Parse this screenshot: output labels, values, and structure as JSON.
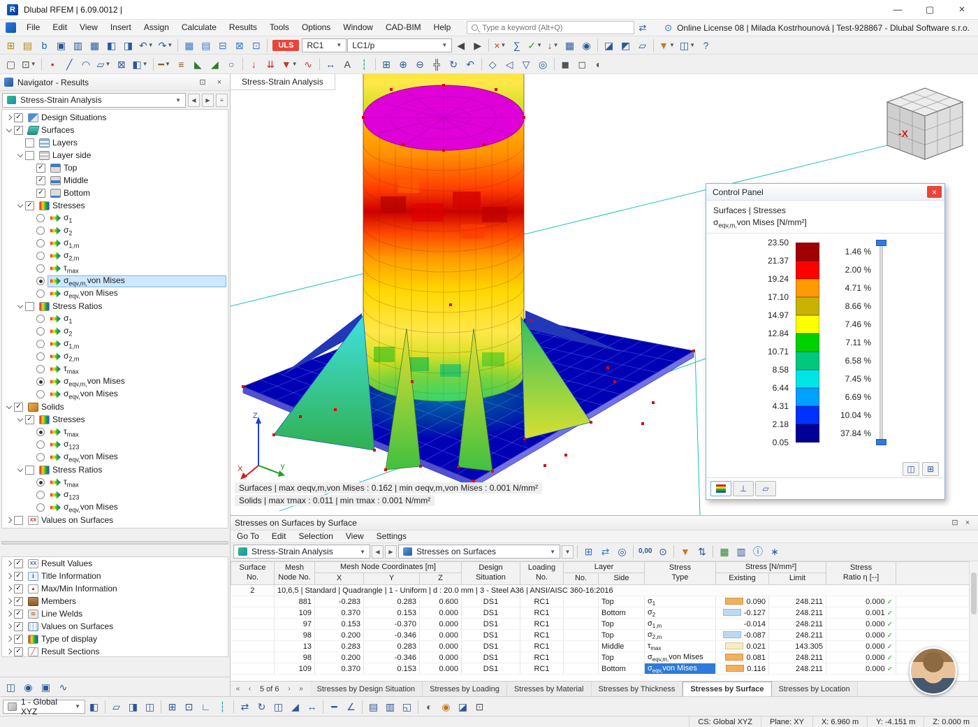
{
  "window": {
    "app_icon": "R",
    "title": "Dlubal RFEM | 6.09.0012 |",
    "license_text": "Online License 08 | Milada Kostrhounová | Test-928867 - Dlubal Software s.r.o."
  },
  "menu": {
    "items": [
      "File",
      "Edit",
      "View",
      "Insert",
      "Assign",
      "Calculate",
      "Results",
      "Tools",
      "Options",
      "Window",
      "CAD-BIM",
      "Help"
    ]
  },
  "search": {
    "placeholder": "Type a keyword (Alt+Q)"
  },
  "toolbar1": {
    "combo_uls": "ULS",
    "combo_rc": "RC1",
    "combo_lc": "LC1/p",
    "icons_a": [
      {
        "n": "new-model",
        "g": "⊞",
        "c": "#b08818"
      },
      {
        "n": "open-model",
        "g": "▤",
        "c": "#b08818"
      },
      {
        "n": "dlubal-home",
        "g": "b",
        "c": "#0a64c8"
      },
      {
        "n": "save-model",
        "g": "▣"
      },
      {
        "n": "print-graphic",
        "g": "▥"
      },
      {
        "n": "printout-report",
        "g": "▦"
      },
      {
        "n": "copy-object",
        "g": "◧"
      },
      {
        "n": "block-manager",
        "g": "◨"
      },
      {
        "n": "undo",
        "g": "↶",
        "drop": true
      },
      {
        "n": "redo",
        "g": "↷",
        "drop": true
      },
      {
        "sep": true
      },
      {
        "n": "goto-table",
        "g": "▦",
        "c": "#3c78c8"
      },
      {
        "n": "table-manager",
        "g": "▤",
        "c": "#3c78c8"
      },
      {
        "n": "table-export",
        "g": "⊟",
        "c": "#3c78c8"
      },
      {
        "n": "table-print",
        "g": "⊠",
        "c": "#3c78c8"
      },
      {
        "n": "table-settings",
        "g": "⊡",
        "c": "#3c78c8"
      },
      {
        "sep": true
      }
    ],
    "icons_b": [
      {
        "n": "previous-loading",
        "g": "◀",
        "c": "#444444"
      },
      {
        "n": "next-loading",
        "g": "▶",
        "c": "#444444"
      },
      {
        "sep": true
      },
      {
        "n": "delete-results",
        "g": "×",
        "c": "#c83232",
        "drop": true
      },
      {
        "n": "calculate-all",
        "g": "∑"
      },
      {
        "n": "show-results",
        "g": "✓",
        "c": "#2e9e2e",
        "drop": true
      },
      {
        "n": "show-loads",
        "g": "↓",
        "c": "#c83232",
        "drop": true
      },
      {
        "n": "show-mesh",
        "g": "▦"
      },
      {
        "n": "show-result-values",
        "g": "◉"
      },
      {
        "sep": true
      },
      {
        "n": "section-plane",
        "g": "◪"
      },
      {
        "n": "clipping-box",
        "g": "◩"
      },
      {
        "n": "comment",
        "g": "▱"
      },
      {
        "sep": true
      },
      {
        "n": "visibility-filter",
        "g": "▼",
        "c": "#c87820",
        "drop": true
      },
      {
        "n": "user-views",
        "g": "◫",
        "drop": true
      },
      {
        "n": "help",
        "g": "?",
        "c": "#0a64c8"
      }
    ]
  },
  "toolbar2": {
    "icons": [
      {
        "n": "select",
        "g": "▢",
        "c": "#555555"
      },
      {
        "n": "select-special",
        "g": "⊡",
        "c": "#555555",
        "drop": true
      },
      {
        "sep": true
      },
      {
        "n": "new-node",
        "g": "•",
        "c": "#c83232"
      },
      {
        "n": "new-line",
        "g": "╱"
      },
      {
        "n": "new-arc",
        "g": "◠"
      },
      {
        "n": "new-surface",
        "g": "▱",
        "drop": true
      },
      {
        "n": "new-opening",
        "g": "⊠"
      },
      {
        "n": "new-solid",
        "g": "◧",
        "drop": true
      },
      {
        "sep": true
      },
      {
        "n": "new-member",
        "g": "━",
        "c": "#8a5a2b",
        "drop": true
      },
      {
        "n": "member-set",
        "g": "≡",
        "c": "#8a5a2b"
      },
      {
        "n": "nodal-support",
        "g": "◣",
        "c": "#2e7d32"
      },
      {
        "n": "line-support",
        "g": "◢",
        "c": "#2e7d32"
      },
      {
        "n": "hinge",
        "g": "○",
        "c": "#555555"
      },
      {
        "sep": true
      },
      {
        "n": "nodal-load",
        "g": "↓",
        "c": "#c83232"
      },
      {
        "n": "line-load",
        "g": "⇊",
        "c": "#c83232"
      },
      {
        "n": "surface-load",
        "g": "▼",
        "c": "#c83232",
        "drop": true
      },
      {
        "n": "imperfection",
        "g": "∿",
        "c": "#c83232"
      },
      {
        "sep": true
      },
      {
        "n": "dimension",
        "g": "↔"
      },
      {
        "n": "text-annotation",
        "g": "A",
        "c": "#444444"
      },
      {
        "n": "guideline",
        "g": "┆",
        "c": "#00a0a0"
      },
      {
        "sep": true
      },
      {
        "n": "zoom-window",
        "g": "⊞"
      },
      {
        "n": "zoom-in",
        "g": "⊕"
      },
      {
        "n": "zoom-out",
        "g": "⊖"
      },
      {
        "n": "pan-view",
        "g": "╬",
        "c": "#444444"
      },
      {
        "n": "rotate-view",
        "g": "↻"
      },
      {
        "n": "previous-view",
        "g": "↶"
      },
      {
        "sep": true
      },
      {
        "n": "isometric-view",
        "g": "◇"
      },
      {
        "n": "view-in-x",
        "g": "◁"
      },
      {
        "n": "view-in-y",
        "g": "▽"
      },
      {
        "n": "view-in-z",
        "g": "◎"
      },
      {
        "sep": true
      },
      {
        "n": "render-solid",
        "g": "◼",
        "c": "#555555"
      },
      {
        "n": "render-wireframe",
        "g": "◻",
        "c": "#555555"
      },
      {
        "n": "render-shadow",
        "g": "◐",
        "c": "#555555"
      }
    ]
  },
  "navigator": {
    "title": "Navigator - Results",
    "combo": "Stress-Strain Analysis",
    "tree": [
      {
        "d": 0,
        "e": "closed",
        "c": "check",
        "v": true,
        "icon": "design",
        "label": "Design Situations"
      },
      {
        "d": 0,
        "e": "open",
        "c": "check",
        "v": true,
        "icon": "surfaces",
        "label": "Surfaces"
      },
      {
        "d": 1,
        "c": "check",
        "v": false,
        "icon": "layers",
        "label": "Layers"
      },
      {
        "d": 1,
        "e": "open",
        "c": "check",
        "v": false,
        "icon": "layerside",
        "label": "Layer side"
      },
      {
        "d": 2,
        "c": "check",
        "v": true,
        "icon": "ltop",
        "label": "Top"
      },
      {
        "d": 2,
        "c": "check",
        "v": true,
        "icon": "lmid",
        "label": "Middle"
      },
      {
        "d": 2,
        "c": "check",
        "v": true,
        "icon": "lbot",
        "label": "Bottom"
      },
      {
        "d": 1,
        "e": "open",
        "c": "check",
        "v": true,
        "icon": "stresses",
        "label": "Stresses"
      },
      {
        "d": 2,
        "c": "radio",
        "v": false,
        "icon": "sigma",
        "label": "σ1"
      },
      {
        "d": 2,
        "c": "radio",
        "v": false,
        "icon": "sigma",
        "label": "σ2"
      },
      {
        "d": 2,
        "c": "radio",
        "v": false,
        "icon": "sigma",
        "label": "σ1,m"
      },
      {
        "d": 2,
        "c": "radio",
        "v": false,
        "icon": "sigma",
        "label": "σ2,m"
      },
      {
        "d": 2,
        "c": "radio",
        "v": false,
        "icon": "sigma",
        "label": "τmax"
      },
      {
        "d": 2,
        "c": "radio",
        "v": true,
        "sel": true,
        "icon": "sigma",
        "label": "σeqv,m,von Mises"
      },
      {
        "d": 2,
        "c": "radio",
        "v": false,
        "icon": "sigma",
        "label": "σeqv,von Mises"
      },
      {
        "d": 1,
        "e": "open",
        "c": "check",
        "v": false,
        "icon": "stresses",
        "label": "Stress Ratios"
      },
      {
        "d": 2,
        "c": "radio",
        "v": false,
        "icon": "sigma",
        "label": "σ1"
      },
      {
        "d": 2,
        "c": "radio",
        "v": false,
        "icon": "sigma",
        "label": "σ2"
      },
      {
        "d": 2,
        "c": "radio",
        "v": false,
        "icon": "sigma",
        "label": "σ1,m"
      },
      {
        "d": 2,
        "c": "radio",
        "v": false,
        "icon": "sigma",
        "label": "σ2,m"
      },
      {
        "d": 2,
        "c": "radio",
        "v": false,
        "icon": "sigma",
        "label": "τmax"
      },
      {
        "d": 2,
        "c": "radio",
        "v": true,
        "icon": "sigma",
        "label": "σeqv,m,von Mises"
      },
      {
        "d": 2,
        "c": "radio",
        "v": false,
        "icon": "sigma",
        "label": "σeqv,von Mises"
      },
      {
        "d": 0,
        "e": "open",
        "c": "check",
        "v": true,
        "icon": "solids",
        "label": "Solids"
      },
      {
        "d": 1,
        "e": "open",
        "c": "check",
        "v": true,
        "icon": "stresses",
        "label": "Stresses"
      },
      {
        "d": 2,
        "c": "radio",
        "v": true,
        "icon": "sigma",
        "label": "τmax"
      },
      {
        "d": 2,
        "c": "radio",
        "v": false,
        "icon": "sigma",
        "label": "σ123"
      },
      {
        "d": 2,
        "c": "radio",
        "v": false,
        "icon": "sigma",
        "label": "σeqv,von Mises"
      },
      {
        "d": 1,
        "e": "open",
        "c": "check",
        "v": false,
        "icon": "stresses",
        "label": "Stress Ratios"
      },
      {
        "d": 2,
        "c": "radio",
        "v": true,
        "icon": "sigma",
        "label": "τmax"
      },
      {
        "d": 2,
        "c": "radio",
        "v": false,
        "icon": "sigma",
        "label": "σ123"
      },
      {
        "d": 2,
        "c": "radio",
        "v": false,
        "icon": "sigma",
        "label": "σeqv,von Mises"
      },
      {
        "d": 0,
        "e": "closed",
        "c": "check",
        "v": false,
        "icon": "xx",
        "label": "Values on Surfaces"
      }
    ],
    "bottom_items": [
      {
        "icon": "result-values",
        "label": "Result Values"
      },
      {
        "icon": "title-info",
        "label": "Title Information"
      },
      {
        "icon": "maxmin-info",
        "label": "Max/Min Information"
      },
      {
        "icon": "members",
        "label": "Members"
      },
      {
        "icon": "line-welds",
        "label": "Line Welds"
      },
      {
        "icon": "values-surfaces",
        "label": "Values on Surfaces"
      },
      {
        "icon": "display-type",
        "label": "Type of display"
      },
      {
        "icon": "result-sections",
        "label": "Result Sections"
      }
    ],
    "minibar_icons": [
      {
        "n": "panels-toggle",
        "g": "◫"
      },
      {
        "n": "visibility-eye",
        "g": "◉"
      },
      {
        "n": "camera",
        "g": "▣"
      },
      {
        "n": "result-diagram",
        "g": "∿"
      }
    ]
  },
  "viewport": {
    "tab": "Stress-Strain Analysis",
    "status_line1": "Surfaces | max σeqv,m,von Mises : 0.162 | min σeqv,m,von Mises : 0.001 N/mm²",
    "status_line2": "Solids | max τmax : 0.011 | min τmax : 0.001 N/mm²",
    "axis": {
      "x": "X",
      "y": "y",
      "z": "Z"
    },
    "nav_cube_label": "-X"
  },
  "control_panel": {
    "title": "Control Panel",
    "subtitle": "Surfaces | Stresses",
    "quantity": "σeqv,m,von Mises",
    "unit": "[N/mm²]",
    "values": [
      "23.50",
      "21.37",
      "19.24",
      "17.10",
      "14.97",
      "12.84",
      "10.71",
      "8.58",
      "6.44",
      "4.31",
      "2.18",
      "0.05"
    ],
    "colors": [
      "#a00000",
      "#ff0000",
      "#ff9900",
      "#c8b400",
      "#ffff00",
      "#00d200",
      "#00c87d",
      "#00e6e6",
      "#00a0ff",
      "#0032ff",
      "#000096"
    ],
    "percents": [
      "1.46 %",
      "2.00 %",
      "4.71 %",
      "8.66 %",
      "7.46 %",
      "7.11 %",
      "6.58 %",
      "7.45 %",
      "6.69 %",
      "10.04 %",
      "37.84 %"
    ]
  },
  "table": {
    "title": "Stresses on Surfaces by Surface",
    "menu": [
      "Go To",
      "Edit",
      "Selection",
      "View",
      "Settings"
    ],
    "combo1": "Stress-Strain Analysis",
    "combo2": "Stresses on Surfaces",
    "toolbar_icons": [
      {
        "sep": true
      },
      {
        "n": "sync-graphic",
        "g": "⊞",
        "c": "#3c78c8"
      },
      {
        "n": "sync-selection",
        "g": "⇄",
        "c": "#3c78c8"
      },
      {
        "n": "find-in-table",
        "g": "◎"
      },
      {
        "sep": true
      },
      {
        "n": "decimal-places",
        "g": "0,00",
        "text": true
      },
      {
        "n": "units-settings",
        "g": "⊙"
      },
      {
        "sep": true
      },
      {
        "n": "filter-table",
        "g": "▼",
        "c": "#c87820"
      },
      {
        "n": "sort-table",
        "g": "⇅"
      },
      {
        "sep": true
      },
      {
        "n": "export-excel",
        "g": "▦",
        "c": "#2e7d32"
      },
      {
        "n": "print-table",
        "g": "▥"
      },
      {
        "n": "table-info",
        "g": "ⓘ",
        "c": "#0a64c8"
      },
      {
        "n": "table-options",
        "g": "∗"
      }
    ],
    "header_row1": [
      {
        "label": "Surface\nNo.",
        "rowspan": 2
      },
      {
        "label": "Mesh\nNode No.",
        "rowspan": 2
      },
      {
        "label": "Mesh Node Coordinates [m]",
        "colspan": 3
      },
      {
        "label": "Design\nSituation",
        "rowspan": 2
      },
      {
        "label": "Loading\nNo.",
        "rowspan": 2
      },
      {
        "label": "Layer",
        "colspan": 2
      },
      {
        "label": "Stress\nType",
        "rowspan": 2
      },
      {
        "label": "Stress [N/mm²]",
        "colspan": 2
      },
      {
        "label": "Stress\nRatio η [--]",
        "rowspan": 2
      },
      {
        "label": "",
        "rowspan": 2
      }
    ],
    "header_row2": [
      "X",
      "Y",
      "Z",
      "No.",
      "Side",
      "Existing",
      "Limit"
    ],
    "group_row": {
      "surface": "2",
      "text": "10,6,5 | Standard | Quadrangle | 1 - Uniform | d : 20.0 mm | 3 - Steel A36 | ANSI/AISC 360-16:2016"
    },
    "rows": [
      {
        "node": "881",
        "x": "-0.283",
        "y": "0.283",
        "z": "0.600",
        "ds": "DS1",
        "loading": "RC1",
        "layer_no": "",
        "side": "Top",
        "type": "σ1",
        "chip": "#f2b05a",
        "existing": "0.090",
        "limit": "248.211",
        "ratio": "0.000"
      },
      {
        "node": "109",
        "x": "0.370",
        "y": "0.153",
        "z": "0.000",
        "ds": "DS1",
        "loading": "RC1",
        "layer_no": "",
        "side": "Bottom",
        "type": "σ2",
        "chip": "#bcd9f2",
        "existing": "-0.127",
        "limit": "248.211",
        "ratio": "0.001"
      },
      {
        "node": "97",
        "x": "0.153",
        "y": "-0.370",
        "z": "0.000",
        "ds": "DS1",
        "loading": "RC1",
        "layer_no": "",
        "side": "Top",
        "type": "σ1,m",
        "chip": "",
        "existing": "-0.014",
        "limit": "248.211",
        "ratio": "0.000"
      },
      {
        "node": "98",
        "x": "0.200",
        "y": "-0.346",
        "z": "0.000",
        "ds": "DS1",
        "loading": "RC1",
        "layer_no": "",
        "side": "Top",
        "type": "σ2,m",
        "chip": "#bcd9f2",
        "existing": "-0.087",
        "limit": "248.211",
        "ratio": "0.000"
      },
      {
        "node": "13",
        "x": "0.283",
        "y": "0.283",
        "z": "0.000",
        "ds": "DS1",
        "loading": "RC1",
        "layer_no": "",
        "side": "Middle",
        "type": "τmax",
        "chip": "#f7edba",
        "existing": "0.021",
        "limit": "143.305",
        "ratio": "0.000"
      },
      {
        "node": "98",
        "x": "0.200",
        "y": "-0.346",
        "z": "0.000",
        "ds": "DS1",
        "loading": "RC1",
        "layer_no": "",
        "side": "Top",
        "type": "σeqv,m,von Mises",
        "chip": "#f2b05a",
        "existing": "0.081",
        "limit": "248.211",
        "ratio": "0.000"
      },
      {
        "node": "109",
        "x": "0.370",
        "y": "0.153",
        "z": "0.000",
        "ds": "DS1",
        "loading": "RC1",
        "layer_no": "",
        "side": "Bottom",
        "type": "σeqv,von Mises",
        "type_selected": true,
        "chip": "#f2b05a",
        "existing": "0.116",
        "limit": "248.211",
        "ratio": "0.000"
      }
    ],
    "pager": "5 of 6",
    "tabs": [
      {
        "label": "Stresses by Design Situation"
      },
      {
        "label": "Stresses by Loading"
      },
      {
        "label": "Stresses by Material"
      },
      {
        "label": "Stresses by Thickness"
      },
      {
        "label": "Stresses by Surface",
        "active": true
      },
      {
        "label": "Stresses by Location"
      }
    ]
  },
  "bottom_toolbar": {
    "combo": "1 - Global XYZ",
    "icons": [
      {
        "n": "pane-layout",
        "g": "◧"
      },
      {
        "sep": true
      },
      {
        "n": "work-plane-xy",
        "g": "▱"
      },
      {
        "n": "work-plane-yz",
        "g": "◨"
      },
      {
        "n": "work-plane-xz",
        "g": "◫"
      },
      {
        "sep": true
      },
      {
        "n": "grid",
        "g": "⊞"
      },
      {
        "n": "snap",
        "g": "⊡"
      },
      {
        "n": "ortho-mode",
        "g": "∟"
      },
      {
        "n": "guidelines-toggle",
        "g": "┆",
        "c": "#00a0a0"
      },
      {
        "sep": true
      },
      {
        "n": "move-copy",
        "g": "⇄"
      },
      {
        "n": "rotate-objects",
        "g": "↻"
      },
      {
        "n": "mirror-objects",
        "g": "◫"
      },
      {
        "n": "divide-line",
        "g": "◢"
      },
      {
        "n": "measure",
        "g": "↔"
      },
      {
        "sep": true
      },
      {
        "n": "dimension-linear",
        "g": "━"
      },
      {
        "n": "dimension-angular",
        "g": "∠"
      },
      {
        "sep": true
      },
      {
        "n": "layers-manager",
        "g": "▤"
      },
      {
        "n": "display-properties",
        "g": "▥"
      },
      {
        "n": "margins-stamp",
        "g": "◱"
      },
      {
        "sep": true
      },
      {
        "n": "render-mode",
        "g": "◐",
        "c": "#555555"
      },
      {
        "n": "light-settings",
        "g": "◉",
        "c": "#c87820"
      },
      {
        "n": "clipping-planes",
        "g": "◪"
      },
      {
        "n": "full-screen",
        "g": "⊡",
        "c": "#555555"
      }
    ]
  },
  "statusbar": {
    "cs": "CS: Global XYZ",
    "plane": "Plane: XY",
    "x": "X: 6.960 m",
    "y": "Y: -4.151 m",
    "z": "Z: 0.000 m"
  }
}
